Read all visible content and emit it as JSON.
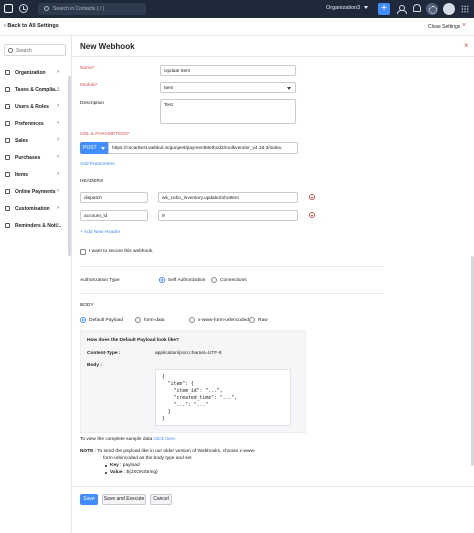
{
  "topbar": {
    "search_placeholder": "Search in Contacts ( / )",
    "org_name": "Organization3",
    "plus_label": "+"
  },
  "settings": {
    "back_label": "Back to All Settings",
    "close_label": "Close Settings",
    "close_symbol": "×"
  },
  "sidebar": {
    "search_placeholder": "Search",
    "items": [
      {
        "label": "Organization",
        "icon": "building-icon"
      },
      {
        "label": "Taxes & Complia...",
        "icon": "tax-icon"
      },
      {
        "label": "Users & Roles",
        "icon": "users-icon"
      },
      {
        "label": "Preferences",
        "icon": "preferences-icon"
      },
      {
        "label": "Sales",
        "icon": "sales-icon"
      },
      {
        "label": "Purchases",
        "icon": "purchases-icon"
      },
      {
        "label": "Items",
        "icon": "items-icon"
      },
      {
        "label": "Online Payments",
        "icon": "payments-icon"
      },
      {
        "label": "Customisation",
        "icon": "customisation-icon"
      },
      {
        "label": "Reminders & Noti...",
        "icon": "reminders-icon"
      }
    ],
    "arrow": "›"
  },
  "page": {
    "title": "New Webhook",
    "close_symbol": "×"
  },
  "form": {
    "name_label": "Name",
    "name_value": "Update Item",
    "module_label": "Module",
    "module_value": "Item",
    "description_label": "Description",
    "description_value": "Test",
    "url_label": "URL & PARAMETERS",
    "method": "POST",
    "url_value": "https://cscarttest.webkul.in/gunjeet/paymentMethod2/multivendor_v4.16.3/index.",
    "add_parameters": "Add Parameters",
    "required_mark": "*",
    "headers_label": "HEADERS",
    "headers": [
      {
        "key": "dispatch",
        "value": "wk_zoho_inventory.updateZohoItem"
      },
      {
        "key": "account_id",
        "value": "9"
      }
    ],
    "add_header": "+ Add New Header",
    "secure_label": "I want to secure this webhook.",
    "auth_type_label": "Authorization Type",
    "auth_options": [
      "Self Authorization",
      "Connections"
    ],
    "auth_selected": "Self Authorization",
    "body_label": "BODY",
    "body_options": [
      "Default Payload",
      "form-data",
      "x-www-form-urlencoded",
      "Raw"
    ],
    "body_selected": "Default Payload"
  },
  "payload": {
    "title": "How does the Default Payload look like?",
    "content_type_key": "Content-Type :",
    "content_type_value": "application/json;charset=UTF-8",
    "body_key": "Body :",
    "code_lines": [
      "{",
      "  \"item\": {",
      "    \"item_id\": \"...\",",
      "    \"created_time\": \"...\",",
      "    \"...\": \"...\"",
      "  }",
      "}"
    ]
  },
  "notes": {
    "sample_text": "To view the complete sample data",
    "sample_link": "Click here.",
    "note_label": "NOTE",
    "note_line1": " :  To send the payload like in our older version of Webhooks, choose x-www-",
    "note_line2": "form-urlencoded as the body type and set",
    "key_label": "Key",
    "key_value": " : payload",
    "value_label": "Value",
    "value_value": " : ${JSONString}"
  },
  "footer": {
    "save": "Save",
    "save_execute": "Save and Execute",
    "cancel": "Cancel"
  },
  "colors": {
    "topbar": "#1e2a3a",
    "accent": "#408dfb",
    "danger": "#d9534f"
  }
}
